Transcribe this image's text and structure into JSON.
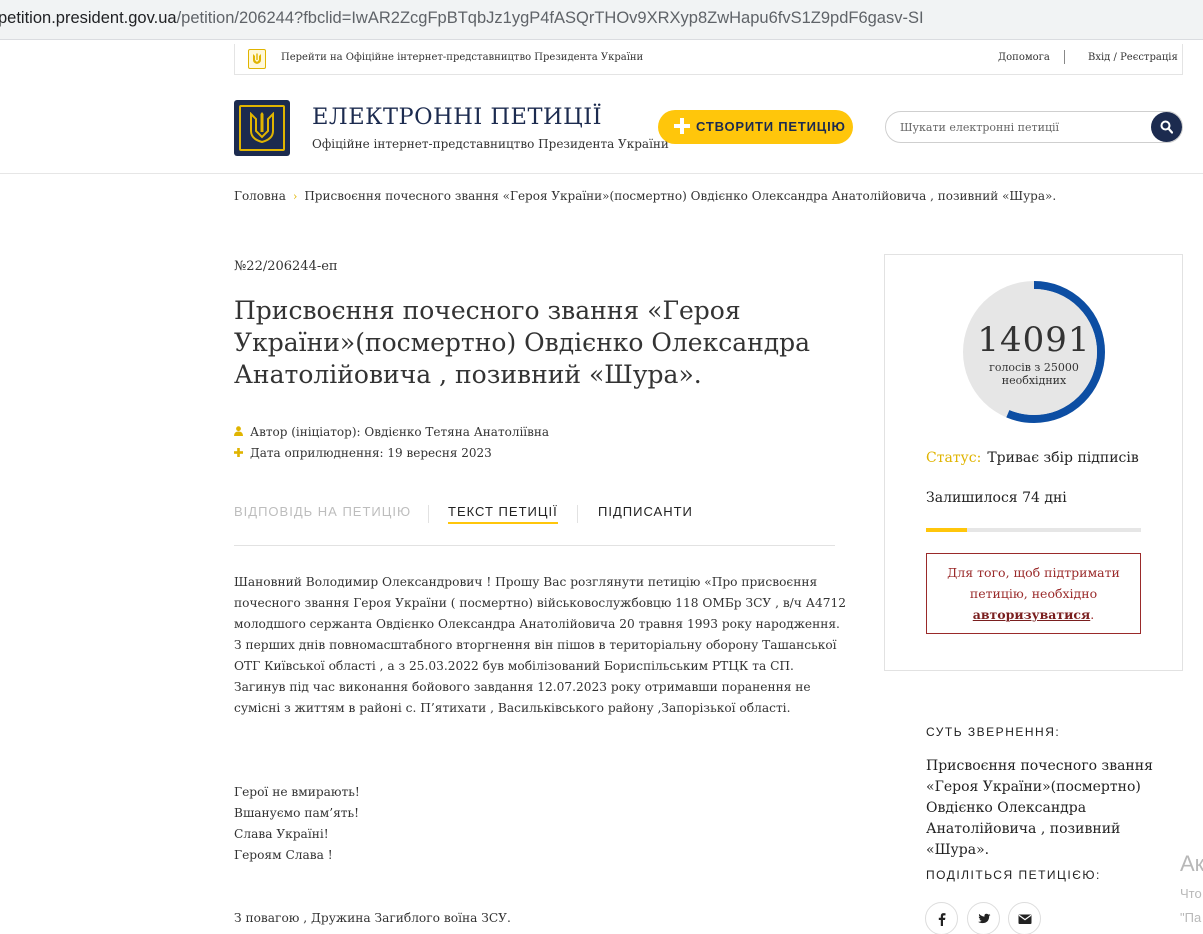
{
  "browser": {
    "url_host": "petition.president.gov.ua",
    "url_path": "/petition/206244?fbclid=IwAR2ZcgFpBTqbJz1ygP4fASQrTHOv9XRXyp8ZwHapu6fvS1Z9pdF6gasv-SI"
  },
  "topbar": {
    "official_link": "Перейти на Офіційне інтернет-представництво Президента України",
    "help": "Допомога",
    "login": "Вхід / Реєстрація"
  },
  "header": {
    "title": "ЕЛЕКТРОННІ ПЕТИЦІЇ",
    "subtitle": "Офіційне інтернет-представництво Президента України",
    "create_button": "СТВОРИТИ ПЕТИЦІЮ",
    "search_placeholder": "Шукати електронні петиції"
  },
  "breadcrumb": {
    "home": "Головна",
    "separator": "›",
    "current": "Присвоєння почесного звання «Героя України»(посмертно) Овдієнко Олександра Анатолійовича , позивний «Шура»."
  },
  "petition": {
    "number": "№22/206244-еп",
    "title": "Присвоєння почесного звання «Героя України»(посмертно) Овдієнко Олександра Анатолійовича , позивний «Шура».",
    "author": "Автор (ініціатор): Овдієнко Тетяна Анатоліївна",
    "date": "Дата оприлюднення: 19 вересня 2023",
    "tabs": {
      "answer": "ВІДПОВІДЬ НА ПЕТИЦІЮ",
      "text": "ТЕКСТ ПЕТИЦІЇ",
      "signers": "ПІДПИСАНТИ"
    },
    "body_lines": [
      "Шановний Володимир Олександрович ! Прошу Вас розглянути петицію «Про присвоєння",
      "почесного звання Героя України ( посмертно) військовослужбовцю 118 ОМБр ЗСУ , в/ч А4712",
      "молодшого сержанта Овдієнко Олександра Анатолійовича 20 травня 1993 року народження.",
      "З перших днів повномасштабного вторгнення він пішов в територіальну оборону Ташанської",
      "ОТГ Київської області , а з 25.03.2022 був мобілізований Бориспільським РТЦК та СП.",
      "Загинув під час виконання бойового завдання 12.07.2023 року отримавши поранення не",
      "сумісні з життям в районі с. П’ятихати , Васильківського району ,Запорізької області."
    ],
    "closing_lines": [
      "Герої не вмирають!",
      "Вшануємо пам’ять!",
      "Слава Україні!",
      "Героям Слава !"
    ],
    "signature": "З повагою , Дружина Загиблого воїна ЗСУ."
  },
  "votes": {
    "count": "14091",
    "needed_line1": "голосів з 25000",
    "needed_line2": "необхідних",
    "progress_fraction": 0.5636,
    "status_label": "Статус:",
    "status_value": "Триває збір підписів",
    "days_left": "Залишилося 74 дні",
    "days_progress_fraction": 0.19,
    "auth_text_1": "Для того, щоб підтримати",
    "auth_text_2": "петицію, необхідно",
    "auth_link": "авторизуватися",
    "auth_end": "."
  },
  "sidebar": {
    "summary_heading": "СУТЬ ЗВЕРНЕННЯ:",
    "summary_lines": [
      "Присвоєння почесного звання",
      "«Героя України»(посмертно)",
      "Овдієнко Олександра",
      "Анатолійовича , позивний «Шура»."
    ],
    "share_heading": "ПОДІЛІТЬСЯ ПЕТИЦІЄЮ:",
    "share_icons": [
      "facebook-icon",
      "twitter-icon",
      "mail-icon"
    ]
  },
  "watermark": {
    "line1": "Ак",
    "line2": "Что",
    "line3": "\"Па"
  },
  "colors": {
    "navy": "#1c2b4f",
    "accent_yellow": "#ffc60b",
    "progress_blue": "#0d4ea3",
    "auth_red": "#9a2a2a"
  }
}
